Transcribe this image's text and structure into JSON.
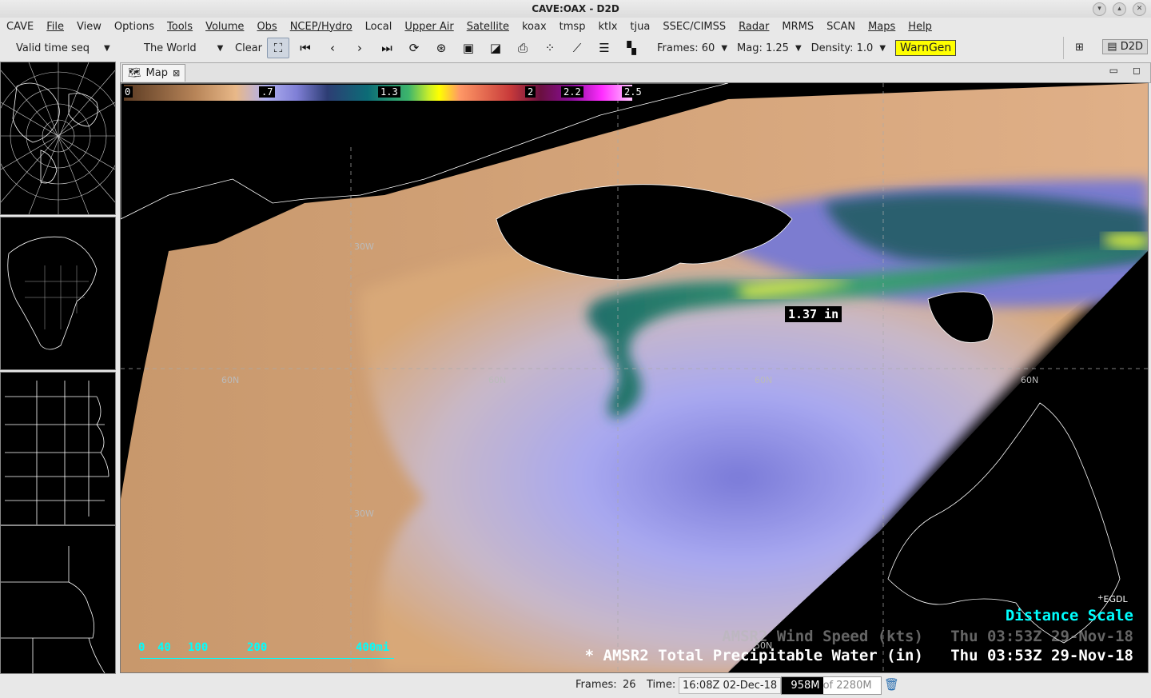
{
  "window": {
    "title": "CAVE:OAX - D2D",
    "buttons": [
      "minimize",
      "maximize",
      "close"
    ]
  },
  "menu": [
    "CAVE",
    "File",
    "View",
    "Options",
    "Tools",
    "Volume",
    "Obs",
    "NCEP/Hydro",
    "Local",
    "Upper Air",
    "Satellite",
    "koax",
    "tmsp",
    "ktlx",
    "tjua",
    "SSEC/CIMSS",
    "Radar",
    "MRMS",
    "SCAN",
    "Maps",
    "Help"
  ],
  "toolbar": {
    "time_mode": "Valid time seq",
    "scale": "The World",
    "clear": "Clear",
    "frames": "Frames: 60",
    "mag": "Mag: 1.25",
    "density": "Density: 1.0",
    "warngen": "WarnGen",
    "perspective": "D2D"
  },
  "tab": {
    "label": "Map"
  },
  "colorbar": {
    "labels": [
      "0",
      ".7",
      "1.3",
      "2",
      "2.2",
      "2.5"
    ]
  },
  "map": {
    "grid_labels": [
      "30W",
      "60N",
      "60N",
      "60N",
      "60N",
      "30W",
      "50N"
    ],
    "sample_readout": "1.37 in",
    "station": "EGDL",
    "distance_scale": "Distance Scale",
    "scale_labels": [
      "0",
      "40",
      "100",
      "200",
      "400mi"
    ],
    "legend_wind": "AMSR2 Wind Speed (kts)   Thu 03:53Z 29-Nov-18",
    "legend_tpw": "* AMSR2 Total Precipitable Water (in)   Thu 03:53Z 29-Nov-18"
  },
  "status": {
    "frames_label": "Frames:",
    "frames_value": "26",
    "time_label": "Time:",
    "time_value": "16:08Z 02-Dec-18",
    "memory_used": "958M",
    "memory_total": "of 2280M",
    "memory_fraction": 0.42
  }
}
